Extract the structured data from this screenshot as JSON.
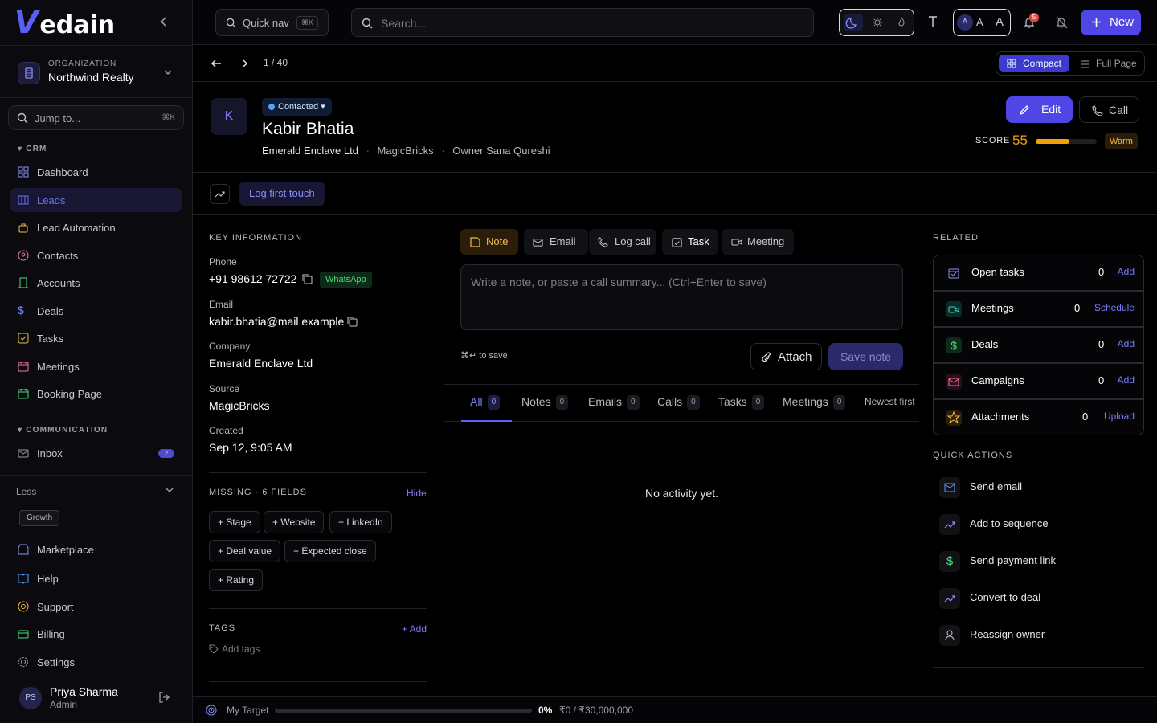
{
  "brand": {
    "logo_v": "V",
    "logo_text": "edain"
  },
  "org": {
    "label": "ORGANIZATION",
    "name": "Northwind Realty"
  },
  "jump": {
    "placeholder": "Jump to...",
    "shortcut": "⌘K"
  },
  "sidebar": {
    "crm_heading": "CRM",
    "crm_items": [
      {
        "label": "Dashboard"
      },
      {
        "label": "Leads"
      },
      {
        "label": "Lead Automation"
      },
      {
        "label": "Contacts"
      },
      {
        "label": "Accounts"
      },
      {
        "label": "Deals"
      },
      {
        "label": "Tasks"
      },
      {
        "label": "Meetings"
      },
      {
        "label": "Booking Page"
      }
    ],
    "comm_heading": "COMMUNICATION",
    "inbox": {
      "label": "Inbox",
      "badge": "2"
    },
    "less": "Less",
    "growth": "Growth",
    "bottom_items": [
      {
        "label": "Marketplace"
      },
      {
        "label": "Help"
      },
      {
        "label": "Support"
      },
      {
        "label": "Billing"
      },
      {
        "label": "Settings"
      }
    ]
  },
  "user": {
    "initials": "PS",
    "name": "Priya Sharma",
    "role": "Admin"
  },
  "topbar": {
    "quicknav": "Quick nav",
    "quicknav_kbd": "⌘K",
    "search_placeholder": "Search...",
    "font_sizes": [
      "A",
      "A",
      "A"
    ],
    "notif_count": "5",
    "new_label": "New"
  },
  "crumb": {
    "page": "1 / 40",
    "compact": "Compact",
    "full": "Full Page"
  },
  "lead": {
    "initial": "K",
    "status": "Contacted",
    "name": "Kabir Bhatia",
    "company": "Emerald Enclave Ltd",
    "source": "MagicBricks",
    "owner": "Owner Sana Qureshi",
    "edit": "Edit",
    "call": "Call",
    "score_label": "SCORE",
    "score": "55",
    "score_value": 0.55,
    "temperature": "Warm",
    "log_touch": "Log first touch"
  },
  "key_info": {
    "heading": "KEY INFORMATION",
    "phone_label": "Phone",
    "phone": "+91 98612 72722",
    "whatsapp": "WhatsApp",
    "email_label": "Email",
    "email": "kabir.bhatia@mail.example",
    "company_label": "Company",
    "company": "Emerald Enclave Ltd",
    "source_label": "Source",
    "source": "MagicBricks",
    "created_label": "Created",
    "created": "Sep 12, 9:05 AM"
  },
  "missing": {
    "heading": "MISSING · 6 FIELDS",
    "hide": "Hide",
    "fields": [
      "+ Stage",
      "+ Website",
      "+ LinkedIn",
      "+ Deal value",
      "+ Expected close",
      "+ Rating"
    ]
  },
  "tags": {
    "heading": "TAGS",
    "add": "+ Add",
    "placeholder": "Add tags"
  },
  "composer": {
    "tabs": [
      "Note",
      "Email",
      "Log call",
      "Task",
      "Meeting"
    ],
    "placeholder": "Write a note, or paste a call summary... (Ctrl+Enter to save)",
    "hint": "⌘↵ to save",
    "attach": "Attach",
    "save": "Save note"
  },
  "activity": {
    "filters": [
      {
        "label": "All",
        "count": "0"
      },
      {
        "label": "Notes",
        "count": "0"
      },
      {
        "label": "Emails",
        "count": "0"
      },
      {
        "label": "Calls",
        "count": "0"
      },
      {
        "label": "Tasks",
        "count": "0"
      },
      {
        "label": "Meetings",
        "count": "0"
      }
    ],
    "sort": "Newest first",
    "empty": "No activity yet."
  },
  "related": {
    "heading": "RELATED",
    "items": [
      {
        "label": "Open tasks",
        "count": "0",
        "action": "Add"
      },
      {
        "label": "Meetings",
        "count": "0",
        "action": "Schedule"
      },
      {
        "label": "Deals",
        "count": "0",
        "action": "Add"
      },
      {
        "label": "Campaigns",
        "count": "0",
        "action": "Add"
      },
      {
        "label": "Attachments",
        "count": "0",
        "action": "Upload"
      }
    ]
  },
  "quick_actions": {
    "heading": "QUICK ACTIONS",
    "items": [
      {
        "label": "Send email"
      },
      {
        "label": "Add to sequence"
      },
      {
        "label": "Send payment link"
      },
      {
        "label": "Convert to deal"
      },
      {
        "label": "Reassign owner"
      }
    ]
  },
  "target": {
    "label": "My Target",
    "percent": "0%",
    "progress": 0,
    "amount": "₹0 / ₹30,000,000"
  },
  "colors": {
    "accent": "#4f46e5",
    "warm": "#f59e0b",
    "whatsapp": "#4ade80",
    "link": "#7b7bf8"
  }
}
